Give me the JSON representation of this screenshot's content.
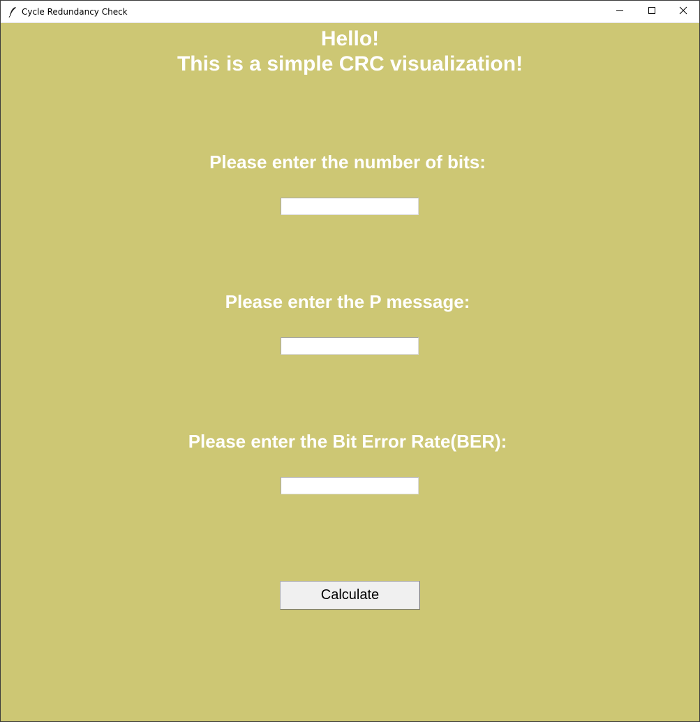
{
  "window": {
    "title": "Cycle Redundancy Check",
    "background_color": "#cdc774",
    "icons": {
      "app": "feather-icon",
      "minimize": "minimize-icon",
      "maximize": "maximize-icon",
      "close": "close-icon"
    }
  },
  "header": {
    "line1": "Hello!",
    "line2": "This is a simple CRC visualization!"
  },
  "form": {
    "bits_label": "Please enter the number of bits:",
    "bits_value": "",
    "message_label": "Please enter the P message:",
    "message_value": "",
    "ber_label": "Please enter the Bit Error Rate(BER):",
    "ber_value": "",
    "calculate_label": "Calculate"
  }
}
